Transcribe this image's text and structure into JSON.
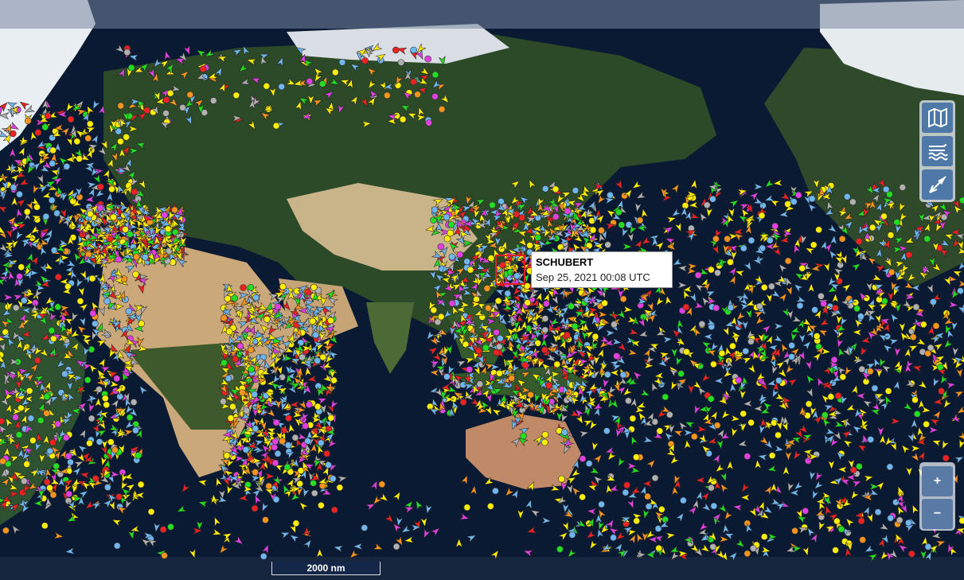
{
  "selected_vessel": {
    "name": "SCHUBERT",
    "timestamp": "Sep 25, 2021 00:08 UTC"
  },
  "scale_bar": {
    "label": "2000 nm"
  },
  "map_controls": {
    "items": [
      {
        "icon": "map-layers-icon"
      },
      {
        "icon": "weather-wind-icon"
      },
      {
        "icon": "compass-icon"
      }
    ]
  },
  "zoom": {
    "in_label": "+",
    "out_label": "−"
  },
  "colors": {
    "ocean": "#0b1a33",
    "vessel_yellow": "#ffee00",
    "vessel_orange": "#f7941d",
    "vessel_blue": "#6fb6ef",
    "vessel_green": "#22dd22",
    "vessel_magenta": "#e040e0",
    "vessel_red": "#ee2222",
    "vessel_gray": "#b0b0b0",
    "control_blue": "#4d78a8",
    "selection": "#e02020"
  }
}
